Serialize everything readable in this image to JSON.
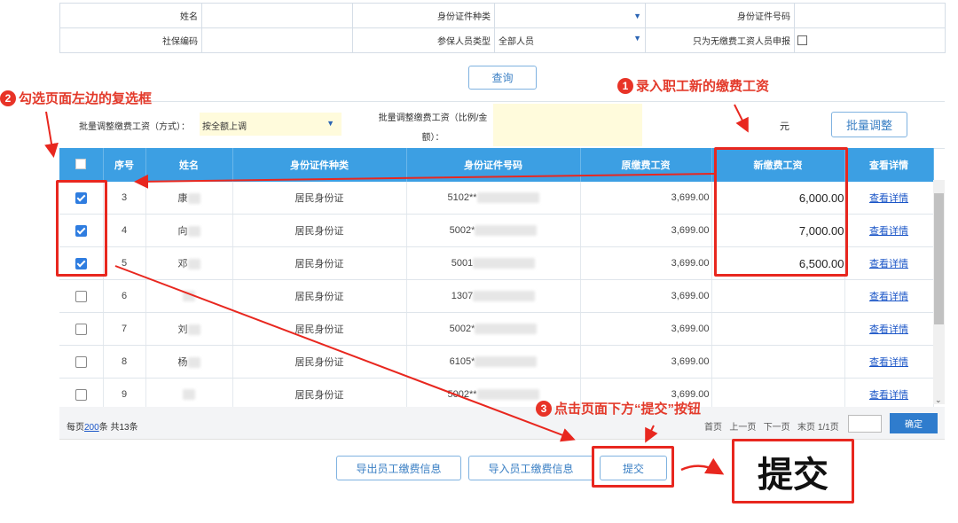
{
  "search_form": {
    "name_label": "姓名",
    "id_type_label": "身份证件种类",
    "id_number_label": "身份证件号码",
    "social_code_label": "社保编码",
    "insured_type_label": "参保人员类型",
    "insured_type_value": "全部人员",
    "only_unpaid_label": "只为无缴费工资人员申报",
    "query_button": "查询"
  },
  "batch": {
    "method_label": "批量调整缴费工资（方式）：",
    "method_value": "按全额上调",
    "ratio_label_1": "批量调整缴费工资（比例/金",
    "ratio_label_2": "额）：",
    "unit": "元",
    "adjust_button": "批量调整"
  },
  "table": {
    "headers": [
      "序号",
      "姓名",
      "身份证件种类",
      "身份证件号码",
      "原缴费工资",
      "新缴费工资",
      "查看详情"
    ],
    "rows": [
      {
        "checked": true,
        "seq": "3",
        "name": "康",
        "id_type": "居民身份证",
        "id_no": "5102**",
        "old_wage": "3,699.00",
        "new_wage": "6,000.00",
        "detail": "查看详情"
      },
      {
        "checked": true,
        "seq": "4",
        "name": "向",
        "id_type": "居民身份证",
        "id_no": "5002*",
        "old_wage": "3,699.00",
        "new_wage": "7,000.00",
        "detail": "查看详情"
      },
      {
        "checked": true,
        "seq": "5",
        "name": "邓",
        "id_type": "居民身份证",
        "id_no": "5001",
        "old_wage": "3,699.00",
        "new_wage": "6,500.00",
        "detail": "查看详情"
      },
      {
        "checked": false,
        "seq": "6",
        "name": "",
        "id_type": "居民身份证",
        "id_no": "1307",
        "old_wage": "3,699.00",
        "new_wage": "",
        "detail": "查看详情"
      },
      {
        "checked": false,
        "seq": "7",
        "name": "刘",
        "id_type": "居民身份证",
        "id_no": "5002*",
        "old_wage": "3,699.00",
        "new_wage": "",
        "detail": "查看详情"
      },
      {
        "checked": false,
        "seq": "8",
        "name": "杨",
        "id_type": "居民身份证",
        "id_no": "6105*",
        "old_wage": "3,699.00",
        "new_wage": "",
        "detail": "查看详情"
      },
      {
        "checked": false,
        "seq": "9",
        "name": "",
        "id_type": "居民身份证",
        "id_no": "5002**",
        "old_wage": "3,699.00",
        "new_wage": "",
        "detail": "查看详情"
      }
    ]
  },
  "pager": {
    "per_page_prefix": "每页",
    "per_page_value": "200",
    "per_page_suffix": "条 共13条",
    "first": "首页",
    "prev": "上一页",
    "next": "下一页",
    "last": "末页",
    "page_info": "1/1页",
    "confirm": "确定"
  },
  "actions": {
    "export_button": "导出员工缴费信息",
    "import_button": "导入员工缴费信息",
    "submit_button": "提交"
  },
  "annotations": {
    "step1_num": "1",
    "step1_text": "录入职工新的缴费工资",
    "step2_num": "2",
    "step2_text": "勾选页面左边的复选框",
    "step3_num": "3",
    "step3_text": "点击页面下方“提交”按钮",
    "big_submit": "提交"
  },
  "colors": {
    "header_blue": "#3c9fe3",
    "annotation_red": "#e8271f",
    "link_blue": "#1a55c7"
  }
}
